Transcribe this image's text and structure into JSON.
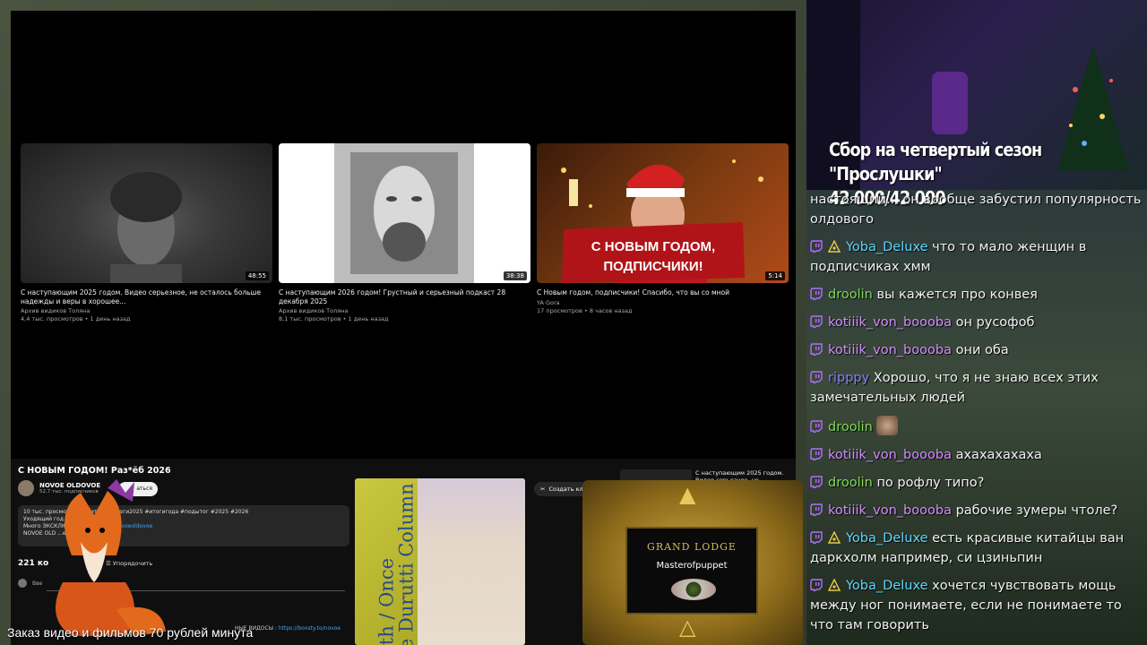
{
  "videos": [
    {
      "title": "С наступающим 2025 годом. Видео серьезное, не осталось больше надежды и веры в хорошее...",
      "channel": "Архив видиков Толяна",
      "meta": "4,4 тыс. просмотров • 1 день назад",
      "duration": "48:55"
    },
    {
      "title": "С наступающим 2026 годом! Грустный и серьезный подкаст 28 декабря 2025",
      "channel": "Архив видиков Толяна",
      "meta": "8,1 тыс. просмотров • 1 день назад",
      "duration": "38:38"
    },
    {
      "title": "С Новым годом, подписчики! Спасибо, что вы со мной",
      "channel": "YA Gora",
      "meta": "17 просмотров • 8 часов назад",
      "duration": "5:14"
    }
  ],
  "thumb3_caption_line1": "С НОВЫМ ГОДОМ,",
  "thumb3_caption_line2": "ПОДПИСЧИКИ!",
  "page": {
    "title": "С НОВЫМ ГОДОМ! Раз*ёб 2026",
    "channel_name": "NOVOE OLDOVOE",
    "channel_subs": "52,7 тыс. подписчиков",
    "subscribe_label": "аться",
    "desc_line1": "10 тыс. просмотров  1",
    "desc_line1b": "#итоги #итоги2025 #итогигода #подытог #2025 #2026",
    "desc_line2": "Уходящий год был",
    "desc_line3_prefix": "Много ЭКСКЛЮ",
    "desc_link": "https://boosty.to/novoeoldovoe",
    "desc_line4": "NOVOE OLD",
    "desc_more": "...ещё",
    "comments_count": "221 ко",
    "sort_label": "Упорядочить",
    "comment_placeholder": "Вве",
    "clip_label": "Создать кл",
    "side_title": "С наступающим 2025 годом. Видео серьезное, не осталось",
    "boosty_prefix": "НЫЕ ВИДОСЫ :",
    "boosty_link": "https://boosty.to/novoe"
  },
  "album": {
    "line1": "Faith / Once",
    "line2": "The Durutti Column"
  },
  "lodge": {
    "title": "GRAND LODGE",
    "name": "Masterofpuppet"
  },
  "order_text": "Заказ видео и фильмов 70 рублей минута",
  "goal": {
    "title": "Сбор на четвертый сезон \"Прослушки\"",
    "progress": "42 000/42 000"
  },
  "chat": [
    {
      "user": "",
      "color": "#ffffff",
      "text": "настоящий... он вообще забустил популярность олдового",
      "vip": false,
      "tw": false
    },
    {
      "user": "Yoba_Deluxe",
      "color": "#5fd7ff",
      "text": "что то мало женщин в подписчиках хмм",
      "vip": true,
      "tw": true
    },
    {
      "user": "droolin",
      "color": "#7ed957",
      "text": "вы кажется про конвея",
      "vip": false,
      "tw": true
    },
    {
      "user": "kotiiik_von_boooba",
      "color": "#d48bff",
      "text": "он русофоб",
      "vip": false,
      "tw": true
    },
    {
      "user": "kotiiik_von_boooba",
      "color": "#d48bff",
      "text": "они оба",
      "vip": false,
      "tw": true
    },
    {
      "user": "ripppy",
      "color": "#8a7dff",
      "text": "Хорошо, что я не знаю всех этих замечательных людей",
      "vip": false,
      "tw": true
    },
    {
      "user": "droolin",
      "color": "#7ed957",
      "text": "",
      "vip": false,
      "tw": true,
      "emote": true
    },
    {
      "user": "kotiiik_von_boooba",
      "color": "#d48bff",
      "text": "ахахахахаха",
      "vip": false,
      "tw": true
    },
    {
      "user": "droolin",
      "color": "#7ed957",
      "text": "по рофлу типо?",
      "vip": false,
      "tw": true
    },
    {
      "user": "kotiiik_von_boooba",
      "color": "#d48bff",
      "text": "рабочие зумеры чтоле?",
      "vip": false,
      "tw": true
    },
    {
      "user": "Yoba_Deluxe",
      "color": "#5fd7ff",
      "text": "есть красивые китайцы ван даркхолм например, си цзиньпин",
      "vip": true,
      "tw": true
    },
    {
      "user": "Yoba_Deluxe",
      "color": "#5fd7ff",
      "text": "хочется чувствовать мощь между ног понимаете, если не понимаете то что там говорить",
      "vip": true,
      "tw": true
    }
  ]
}
